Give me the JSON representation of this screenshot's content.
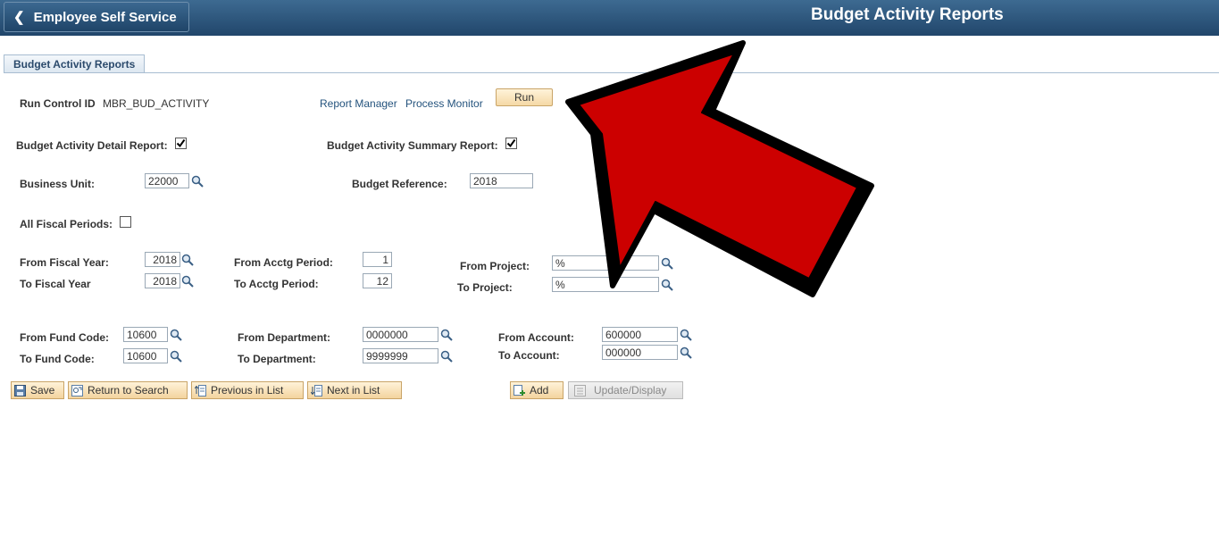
{
  "header": {
    "back_label": "Employee Self Service",
    "title": "Budget Activity Reports"
  },
  "tab": {
    "label": "Budget Activity Reports"
  },
  "run_control": {
    "label": "Run Control ID",
    "value": "MBR_BUD_ACTIVITY",
    "report_manager": "Report Manager",
    "process_monitor": "Process Monitor",
    "run_label": "Run"
  },
  "detail_report": {
    "label": "Budget Activity Detail Report:",
    "checked": true
  },
  "summary_report": {
    "label": "Budget Activity Summary Report:",
    "checked": true
  },
  "business_unit": {
    "label": "Business Unit:",
    "value": "22000"
  },
  "budget_reference": {
    "label": "Budget Reference:",
    "value": "2018"
  },
  "all_fiscal_periods": {
    "label": "All Fiscal Periods:",
    "checked": false
  },
  "fiscal_year": {
    "from_label": "From Fiscal Year:",
    "from_value": "2018",
    "to_label": "To Fiscal Year",
    "to_value": "2018"
  },
  "acctg_period": {
    "from_label": "From Acctg Period:",
    "from_value": "1",
    "to_label": "To Acctg Period:",
    "to_value": "12"
  },
  "project": {
    "from_label": "From Project:",
    "from_value": "%",
    "to_label": "To Project:",
    "to_value": "%"
  },
  "fund_code": {
    "from_label": "From Fund Code:",
    "from_value": "10600",
    "to_label": "To Fund Code:",
    "to_value": "10600"
  },
  "department": {
    "from_label": "From Department:",
    "from_value": "0000000",
    "to_label": "To Department:",
    "to_value": "9999999"
  },
  "account": {
    "from_label": "From Account:",
    "from_value": "600000",
    "to_label": "To Account:",
    "to_value": "000000"
  },
  "toolbar": {
    "save": "Save",
    "return_to_search": "Return to Search",
    "previous_in_list": "Previous in List",
    "next_in_list": "Next in List",
    "add": "Add",
    "update_display": "Update/Display"
  },
  "colors": {
    "header": "#2a5078",
    "button": "#f5d9a6",
    "annotation_arrow": "#cc0000"
  },
  "icons": {
    "back": "chevron-left-icon",
    "lookup": "magnifier-icon",
    "checkbox": "check-icon"
  }
}
